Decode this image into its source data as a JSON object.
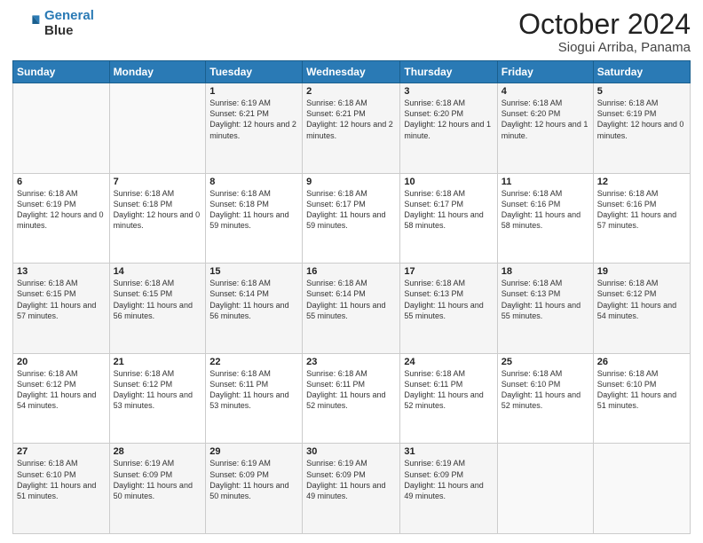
{
  "logo": {
    "line1": "General",
    "line2": "Blue"
  },
  "title": "October 2024",
  "subtitle": "Siogui Arriba, Panama",
  "days_of_week": [
    "Sunday",
    "Monday",
    "Tuesday",
    "Wednesday",
    "Thursday",
    "Friday",
    "Saturday"
  ],
  "weeks": [
    [
      {
        "day": "",
        "info": ""
      },
      {
        "day": "",
        "info": ""
      },
      {
        "day": "1",
        "info": "Sunrise: 6:19 AM\nSunset: 6:21 PM\nDaylight: 12 hours and 2 minutes."
      },
      {
        "day": "2",
        "info": "Sunrise: 6:18 AM\nSunset: 6:21 PM\nDaylight: 12 hours and 2 minutes."
      },
      {
        "day": "3",
        "info": "Sunrise: 6:18 AM\nSunset: 6:20 PM\nDaylight: 12 hours and 1 minute."
      },
      {
        "day": "4",
        "info": "Sunrise: 6:18 AM\nSunset: 6:20 PM\nDaylight: 12 hours and 1 minute."
      },
      {
        "day": "5",
        "info": "Sunrise: 6:18 AM\nSunset: 6:19 PM\nDaylight: 12 hours and 0 minutes."
      }
    ],
    [
      {
        "day": "6",
        "info": "Sunrise: 6:18 AM\nSunset: 6:19 PM\nDaylight: 12 hours and 0 minutes."
      },
      {
        "day": "7",
        "info": "Sunrise: 6:18 AM\nSunset: 6:18 PM\nDaylight: 12 hours and 0 minutes."
      },
      {
        "day": "8",
        "info": "Sunrise: 6:18 AM\nSunset: 6:18 PM\nDaylight: 11 hours and 59 minutes."
      },
      {
        "day": "9",
        "info": "Sunrise: 6:18 AM\nSunset: 6:17 PM\nDaylight: 11 hours and 59 minutes."
      },
      {
        "day": "10",
        "info": "Sunrise: 6:18 AM\nSunset: 6:17 PM\nDaylight: 11 hours and 58 minutes."
      },
      {
        "day": "11",
        "info": "Sunrise: 6:18 AM\nSunset: 6:16 PM\nDaylight: 11 hours and 58 minutes."
      },
      {
        "day": "12",
        "info": "Sunrise: 6:18 AM\nSunset: 6:16 PM\nDaylight: 11 hours and 57 minutes."
      }
    ],
    [
      {
        "day": "13",
        "info": "Sunrise: 6:18 AM\nSunset: 6:15 PM\nDaylight: 11 hours and 57 minutes."
      },
      {
        "day": "14",
        "info": "Sunrise: 6:18 AM\nSunset: 6:15 PM\nDaylight: 11 hours and 56 minutes."
      },
      {
        "day": "15",
        "info": "Sunrise: 6:18 AM\nSunset: 6:14 PM\nDaylight: 11 hours and 56 minutes."
      },
      {
        "day": "16",
        "info": "Sunrise: 6:18 AM\nSunset: 6:14 PM\nDaylight: 11 hours and 55 minutes."
      },
      {
        "day": "17",
        "info": "Sunrise: 6:18 AM\nSunset: 6:13 PM\nDaylight: 11 hours and 55 minutes."
      },
      {
        "day": "18",
        "info": "Sunrise: 6:18 AM\nSunset: 6:13 PM\nDaylight: 11 hours and 55 minutes."
      },
      {
        "day": "19",
        "info": "Sunrise: 6:18 AM\nSunset: 6:12 PM\nDaylight: 11 hours and 54 minutes."
      }
    ],
    [
      {
        "day": "20",
        "info": "Sunrise: 6:18 AM\nSunset: 6:12 PM\nDaylight: 11 hours and 54 minutes."
      },
      {
        "day": "21",
        "info": "Sunrise: 6:18 AM\nSunset: 6:12 PM\nDaylight: 11 hours and 53 minutes."
      },
      {
        "day": "22",
        "info": "Sunrise: 6:18 AM\nSunset: 6:11 PM\nDaylight: 11 hours and 53 minutes."
      },
      {
        "day": "23",
        "info": "Sunrise: 6:18 AM\nSunset: 6:11 PM\nDaylight: 11 hours and 52 minutes."
      },
      {
        "day": "24",
        "info": "Sunrise: 6:18 AM\nSunset: 6:11 PM\nDaylight: 11 hours and 52 minutes."
      },
      {
        "day": "25",
        "info": "Sunrise: 6:18 AM\nSunset: 6:10 PM\nDaylight: 11 hours and 52 minutes."
      },
      {
        "day": "26",
        "info": "Sunrise: 6:18 AM\nSunset: 6:10 PM\nDaylight: 11 hours and 51 minutes."
      }
    ],
    [
      {
        "day": "27",
        "info": "Sunrise: 6:18 AM\nSunset: 6:10 PM\nDaylight: 11 hours and 51 minutes."
      },
      {
        "day": "28",
        "info": "Sunrise: 6:19 AM\nSunset: 6:09 PM\nDaylight: 11 hours and 50 minutes."
      },
      {
        "day": "29",
        "info": "Sunrise: 6:19 AM\nSunset: 6:09 PM\nDaylight: 11 hours and 50 minutes."
      },
      {
        "day": "30",
        "info": "Sunrise: 6:19 AM\nSunset: 6:09 PM\nDaylight: 11 hours and 49 minutes."
      },
      {
        "day": "31",
        "info": "Sunrise: 6:19 AM\nSunset: 6:09 PM\nDaylight: 11 hours and 49 minutes."
      },
      {
        "day": "",
        "info": ""
      },
      {
        "day": "",
        "info": ""
      }
    ]
  ]
}
